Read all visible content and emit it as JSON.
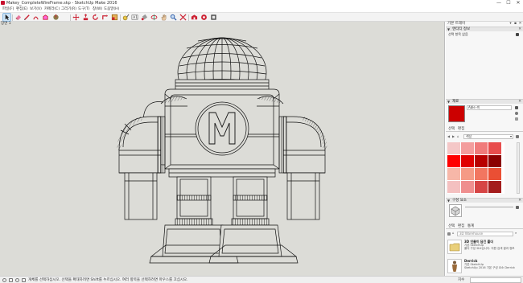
{
  "window": {
    "title": "Makey_CompleteWireFrame.skp - SketchUp Make 2016",
    "controls": [
      "—",
      "☐",
      "✕"
    ]
  },
  "menu": [
    "파일(F)",
    "편집(E)",
    "보기(V)",
    "카메라(C)",
    "그리기(R)",
    "도구(T)",
    "창(W)",
    "도움말(H)"
  ],
  "toolbar": {
    "tools": [
      "select-tool",
      "eraser-tool",
      "line-tool",
      "arc-tool",
      "shape-tool",
      "push-pull-tool",
      "move-tool",
      "rotate-tool",
      "scale-tool",
      "offset-tool",
      "tape-measure-tool",
      "text-tool",
      "paint-bucket-tool",
      "orbit-tool",
      "pan-tool",
      "zoom-tool",
      "zoom-extents-tool",
      "warehouse-tool",
      "extension-tool",
      "layout-tool"
    ]
  },
  "viewport": {
    "scene_label": "장면 1"
  },
  "status": {
    "text": "개체를 선택하십시오. 선택을 확대하려면 Shift를 누르십시오. 여러 항목을 선택하려면 마우스를 끄십시오.",
    "measure_label": "치수"
  },
  "tray": {
    "title": "기본 트레이",
    "entity_info": {
      "header": "엔티티 정보",
      "selection": "선택 항목 없음"
    },
    "materials": {
      "header": "재료",
      "material_name": "Able 색",
      "tabs": [
        "선택",
        "편집"
      ],
      "category": "색상",
      "main_color": "#cc0000",
      "swatches": [
        "#f4c7c7",
        "#f39d9d",
        "#f07b7b",
        "#e84d4d",
        "#ff0000",
        "#e00000",
        "#b80000",
        "#8b0000",
        "#f7b7a8",
        "#f59a85",
        "#f27660",
        "#ea4f34",
        "#f4c0c0",
        "#ef8f8f",
        "#d64545",
        "#a41c1c"
      ]
    },
    "components": {
      "header": "구성 요소",
      "tabs": [
        "선택",
        "편집",
        "통계"
      ],
      "search_placeholder": "3D Warehouse",
      "items": [
        {
          "name": "3D 인물이 담긴 폴더",
          "by": "기본 SketchUp",
          "desc": "폴더 구성 요소입니다. 지원 검색 결과 정보"
        },
        {
          "name": "Derrick",
          "by": "기본 SketchUp",
          "desc": "SketchUp 2016 기본 구성 요소 Derrick"
        }
      ]
    }
  }
}
